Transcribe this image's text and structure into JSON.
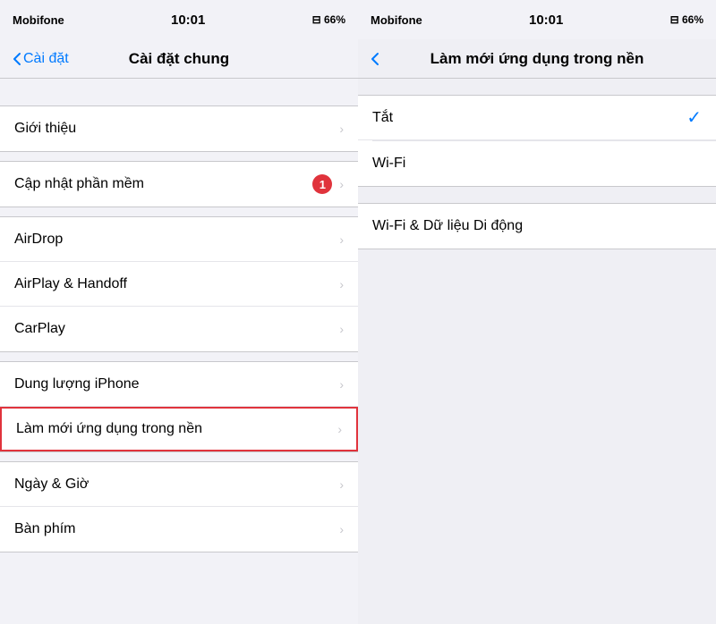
{
  "left": {
    "status": {
      "carrier": "Mobifone",
      "wifi": true,
      "time": "10:01",
      "battery_icon": "66%"
    },
    "nav": {
      "back_label": "Cài đặt",
      "title": "Cài đặt chung"
    },
    "groups": [
      {
        "items": [
          {
            "label": "Giới thiệu",
            "chevron": true,
            "badge": null
          }
        ]
      },
      {
        "items": [
          {
            "label": "Cập nhật phần mềm",
            "chevron": true,
            "badge": "1"
          }
        ]
      },
      {
        "items": [
          {
            "label": "AirDrop",
            "chevron": true,
            "badge": null
          },
          {
            "label": "AirPlay & Handoff",
            "chevron": true,
            "badge": null
          },
          {
            "label": "CarPlay",
            "chevron": true,
            "badge": null
          }
        ]
      },
      {
        "items": [
          {
            "label": "Dung lượng iPhone",
            "chevron": true,
            "badge": null
          },
          {
            "label": "Làm mới ứng dụng trong nền",
            "chevron": true,
            "badge": null,
            "highlighted": true
          }
        ]
      },
      {
        "items": [
          {
            "label": "Ngày & Giờ",
            "chevron": true,
            "badge": null
          },
          {
            "label": "Bàn phím",
            "chevron": true,
            "badge": null
          }
        ]
      }
    ]
  },
  "right": {
    "status": {
      "carrier": "Mobifone",
      "wifi": true,
      "time": "10:01",
      "battery_icon": "66%"
    },
    "nav": {
      "title": "Làm mới ứng dụng trong nền"
    },
    "options_selected": [
      {
        "label": "Tắt",
        "selected": true
      },
      {
        "label": "Wi-Fi",
        "selected": false
      }
    ],
    "options_other": [
      {
        "label": "Wi-Fi & Dữ liệu Di động"
      }
    ]
  }
}
